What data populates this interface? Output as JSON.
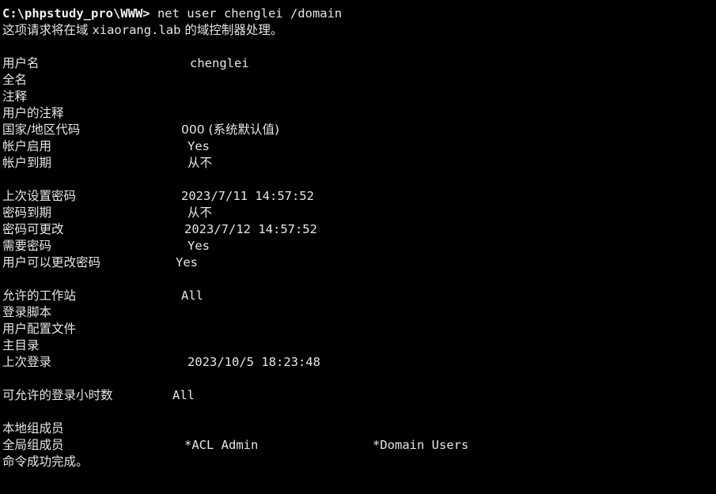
{
  "terminal": {
    "prompt": "C:\\phpstudy_pro\\WWW>",
    "command": " net user chenglei /domain",
    "request_notice_pre": "这项请求将在域 ",
    "domain_name": "xiaorang.lab",
    "request_notice_post": " 的域控制器处理。",
    "fields": [
      {
        "label": "用户名",
        "value": "chenglei"
      },
      {
        "label": "全名",
        "value": ""
      },
      {
        "label": "注释",
        "value": ""
      },
      {
        "label": "用户的注释",
        "value": ""
      },
      {
        "label": "国家/地区代码",
        "value": "000 (系统默认值)"
      },
      {
        "label": "帐户启用",
        "value": "Yes"
      },
      {
        "label": "帐户到期",
        "value": "从不"
      },
      {
        "label": "上次设置密码",
        "value": "2023/7/11 14:57:52"
      },
      {
        "label": "密码到期",
        "value": "从不"
      },
      {
        "label": "密码可更改",
        "value": "2023/7/12 14:57:52"
      },
      {
        "label": "需要密码",
        "value": "Yes"
      },
      {
        "label": "用户可以更改密码",
        "value": "Yes"
      },
      {
        "label": "允许的工作站",
        "value": "All"
      },
      {
        "label": "登录脚本",
        "value": ""
      },
      {
        "label": "用户配置文件",
        "value": ""
      },
      {
        "label": "主目录",
        "value": ""
      },
      {
        "label": "上次登录",
        "value": "2023/10/5 18:23:48"
      },
      {
        "label": "可允许的登录小时数",
        "value": "All"
      },
      {
        "label": "本地组成员",
        "value": ""
      },
      {
        "label": "全局组成员",
        "value": "*ACL Admin"
      },
      {
        "label": "",
        "value": "*Domain Users"
      }
    ],
    "completion": "命令成功完成。"
  }
}
